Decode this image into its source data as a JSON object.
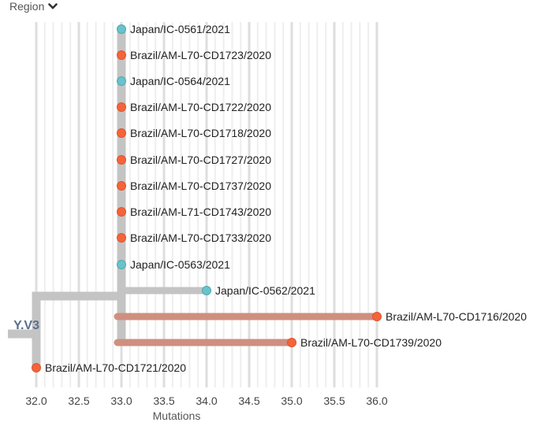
{
  "header": {
    "region_label": "Region"
  },
  "colors": {
    "japan": "#68c3ca",
    "brazil": "#f4643a",
    "branch_default": "#c4c4c4",
    "branch_brazil": "#cf8f80",
    "grid_major": "#dedede",
    "grid_minor": "#eeeeee",
    "clade_label": "#5b6f8f"
  },
  "chart_data": {
    "type": "phylogenetic-tree",
    "xlabel": "Mutations",
    "xlim": [
      32.0,
      36.0
    ],
    "ticks": [
      "32.0",
      "32.5",
      "33.0",
      "33.5",
      "34.0",
      "34.5",
      "35.0",
      "35.5",
      "36.0"
    ],
    "tick_values": [
      32.0,
      32.5,
      33.0,
      33.5,
      34.0,
      34.5,
      35.0,
      35.5,
      36.0
    ],
    "minor_step": 0.1,
    "clade_label": "Y.V3",
    "root_x": 32.0,
    "inner_node_x": 33.0,
    "tips": [
      {
        "name": "Japan/IC-0561/2021",
        "x": 33.0,
        "region": "japan"
      },
      {
        "name": "Brazil/AM-L70-CD1723/2020",
        "x": 33.0,
        "region": "brazil"
      },
      {
        "name": "Japan/IC-0564/2021",
        "x": 33.0,
        "region": "japan"
      },
      {
        "name": "Brazil/AM-L70-CD1722/2020",
        "x": 33.0,
        "region": "brazil"
      },
      {
        "name": "Brazil/AM-L70-CD1718/2020",
        "x": 33.0,
        "region": "brazil"
      },
      {
        "name": "Brazil/AM-L70-CD1727/2020",
        "x": 33.0,
        "region": "brazil"
      },
      {
        "name": "Brazil/AM-L70-CD1737/2020",
        "x": 33.0,
        "region": "brazil"
      },
      {
        "name": "Brazil/AM-L71-CD1743/2020",
        "x": 33.0,
        "region": "brazil"
      },
      {
        "name": "Brazil/AM-L70-CD1733/2020",
        "x": 33.0,
        "region": "brazil"
      },
      {
        "name": "Japan/IC-0563/2021",
        "x": 33.0,
        "region": "japan"
      },
      {
        "name": "Japan/IC-0562/2021",
        "x": 34.0,
        "region": "japan"
      },
      {
        "name": "Brazil/AM-L70-CD1716/2020",
        "x": 36.0,
        "region": "brazil"
      },
      {
        "name": "Brazil/AM-L70-CD1739/2020",
        "x": 35.0,
        "region": "brazil"
      },
      {
        "name": "Brazil/AM-L70-CD1721/2020",
        "x": 32.0,
        "region": "brazil"
      }
    ]
  }
}
